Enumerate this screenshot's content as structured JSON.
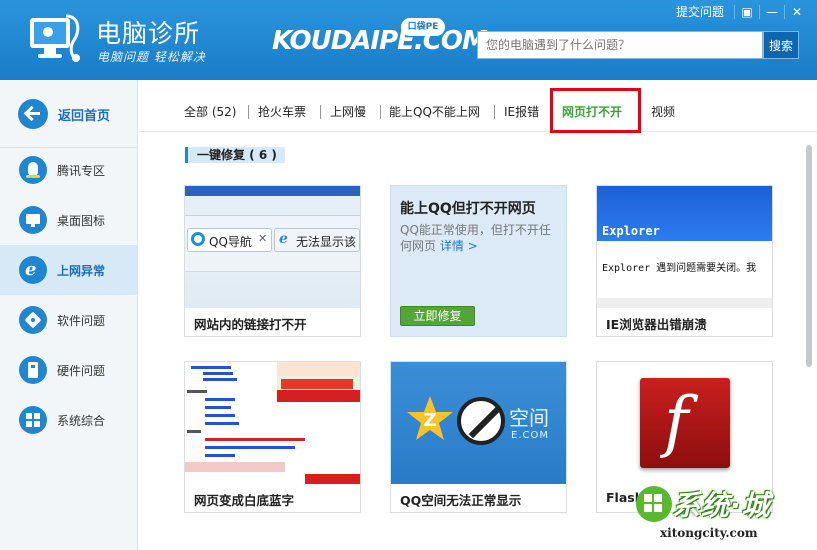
{
  "header": {
    "app_title": "电脑诊所",
    "app_slogan": "电脑问题 轻松解决",
    "brand": "KOUDAIPE.COM",
    "brand_badge": "口袋PE",
    "top_link": "提交问题",
    "search_placeholder": "您的电脑遇到了什么问题？",
    "search_button": "搜索"
  },
  "sidebar": {
    "back_label": "返回首页",
    "items": [
      {
        "label": "腾讯专区",
        "icon": "penguin-icon"
      },
      {
        "label": "桌面图标",
        "icon": "monitor-icon"
      },
      {
        "label": "上网异常",
        "icon": "ie-icon",
        "active": true
      },
      {
        "label": "软件问题",
        "icon": "software-icon"
      },
      {
        "label": "硬件问题",
        "icon": "hardware-icon"
      },
      {
        "label": "系统综合",
        "icon": "windows-icon"
      }
    ]
  },
  "tabs": [
    {
      "label": "全部 (52)"
    },
    {
      "label": "抢火车票"
    },
    {
      "label": "上网慢"
    },
    {
      "label": "能上QQ不能上网"
    },
    {
      "label": "IE报错"
    },
    {
      "label": "网页打不开",
      "active": true
    },
    {
      "label": "视频"
    }
  ],
  "section": {
    "title": "一键修复 ( 6 )"
  },
  "cards": [
    {
      "caption": "网站内的链接打不开",
      "thumb_tab1": "QQ导航",
      "thumb_tab2": "无法显示该"
    },
    {
      "caption": "",
      "title": "能上QQ但打不开网页",
      "desc": "QQ能正常使用，但打不开任何网页",
      "link": "详情 >",
      "button": "立即修复"
    },
    {
      "caption": "IE浏览器出错崩溃",
      "thumb_title": "Explorer",
      "thumb_text": "Explorer 遇到问题需要关闭。我"
    },
    {
      "caption": "网页变成白底蓝字"
    },
    {
      "caption": "QQ空间无法正常显示",
      "thumb_text": "空间",
      "thumb_sub": "E.COM"
    },
    {
      "caption": "Flash"
    }
  ],
  "watermark": {
    "text": "系统·城",
    "sub": "xitongcity.com"
  },
  "colors": {
    "header_blue": "#1f86cf",
    "active_green": "#38a33a",
    "highlight_red": "#e4001a"
  }
}
